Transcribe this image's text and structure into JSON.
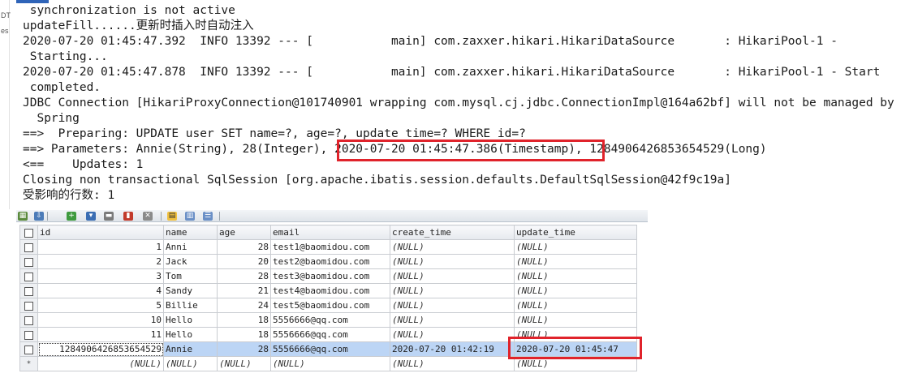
{
  "console": {
    "gutter_labels": [
      "DT",
      "es"
    ],
    "lines": [
      " synchronization is not active",
      "updateFill......更新时插入时自动注入",
      "2020-07-20 01:45:47.392  INFO 13392 --- [           main] com.zaxxer.hikari.HikariDataSource       : HikariPool-1 -",
      " Starting...",
      "2020-07-20 01:45:47.878  INFO 13392 --- [           main] com.zaxxer.hikari.HikariDataSource       : HikariPool-1 - Start",
      " completed.",
      "JDBC Connection [HikariProxyConnection@101740901 wrapping com.mysql.cj.jdbc.ConnectionImpl@164a62bf] will not be managed by",
      "  Spring",
      "==>  Preparing: UPDATE user SET name=?, age=?, update_time=? WHERE id=?",
      "==> Parameters: Annie(String), 28(Integer), 2020-07-20 01:45:47.386(Timestamp), 1284906426853654529(Long)",
      "<==    Updates: 1",
      "Closing non transactional SqlSession [org.apache.ibatis.session.defaults.DefaultSqlSession@42f9c19a]",
      "受影响的行数: 1"
    ]
  },
  "grid": {
    "columns": [
      "id",
      "name",
      "age",
      "email",
      "create_time",
      "update_time"
    ],
    "rows": [
      [
        "1",
        "Anni",
        "28",
        "test1@baomidou.com",
        "(NULL)",
        "(NULL)"
      ],
      [
        "2",
        "Jack",
        "20",
        "test2@baomidou.com",
        "(NULL)",
        "(NULL)"
      ],
      [
        "3",
        "Tom",
        "28",
        "test3@baomidou.com",
        "(NULL)",
        "(NULL)"
      ],
      [
        "4",
        "Sandy",
        "21",
        "test4@baomidou.com",
        "(NULL)",
        "(NULL)"
      ],
      [
        "5",
        "Billie",
        "24",
        "test5@baomidou.com",
        "(NULL)",
        "(NULL)"
      ],
      [
        "10",
        "Hello",
        "18",
        "5556666@qq.com",
        "(NULL)",
        "(NULL)"
      ],
      [
        "11",
        "Hello",
        "18",
        "5556666@qq.com",
        "(NULL)",
        "(NULL)"
      ],
      [
        "1284906426853654529",
        "Annie",
        "28",
        "5556666@qq.com",
        "2020-07-20 01:42:19",
        "2020-07-20 01:45:47"
      ]
    ],
    "new_row": [
      "(NULL)",
      "(NULL)",
      "(NULL)",
      "(NULL)",
      "(NULL)",
      "(NULL)"
    ],
    "new_row_marker": "*",
    "selected_row_index": 7
  },
  "toolbar_icons": [
    "grid-icon",
    "export-icon",
    "add-row-icon",
    "save-icon",
    "revert-icon",
    "delete-icon",
    "cancel-icon",
    "view-grid-icon",
    "view-form-icon",
    "view-text-icon"
  ],
  "colors": {
    "highlight_border": "#e0232b",
    "selected_row": "#bcd5f5"
  }
}
